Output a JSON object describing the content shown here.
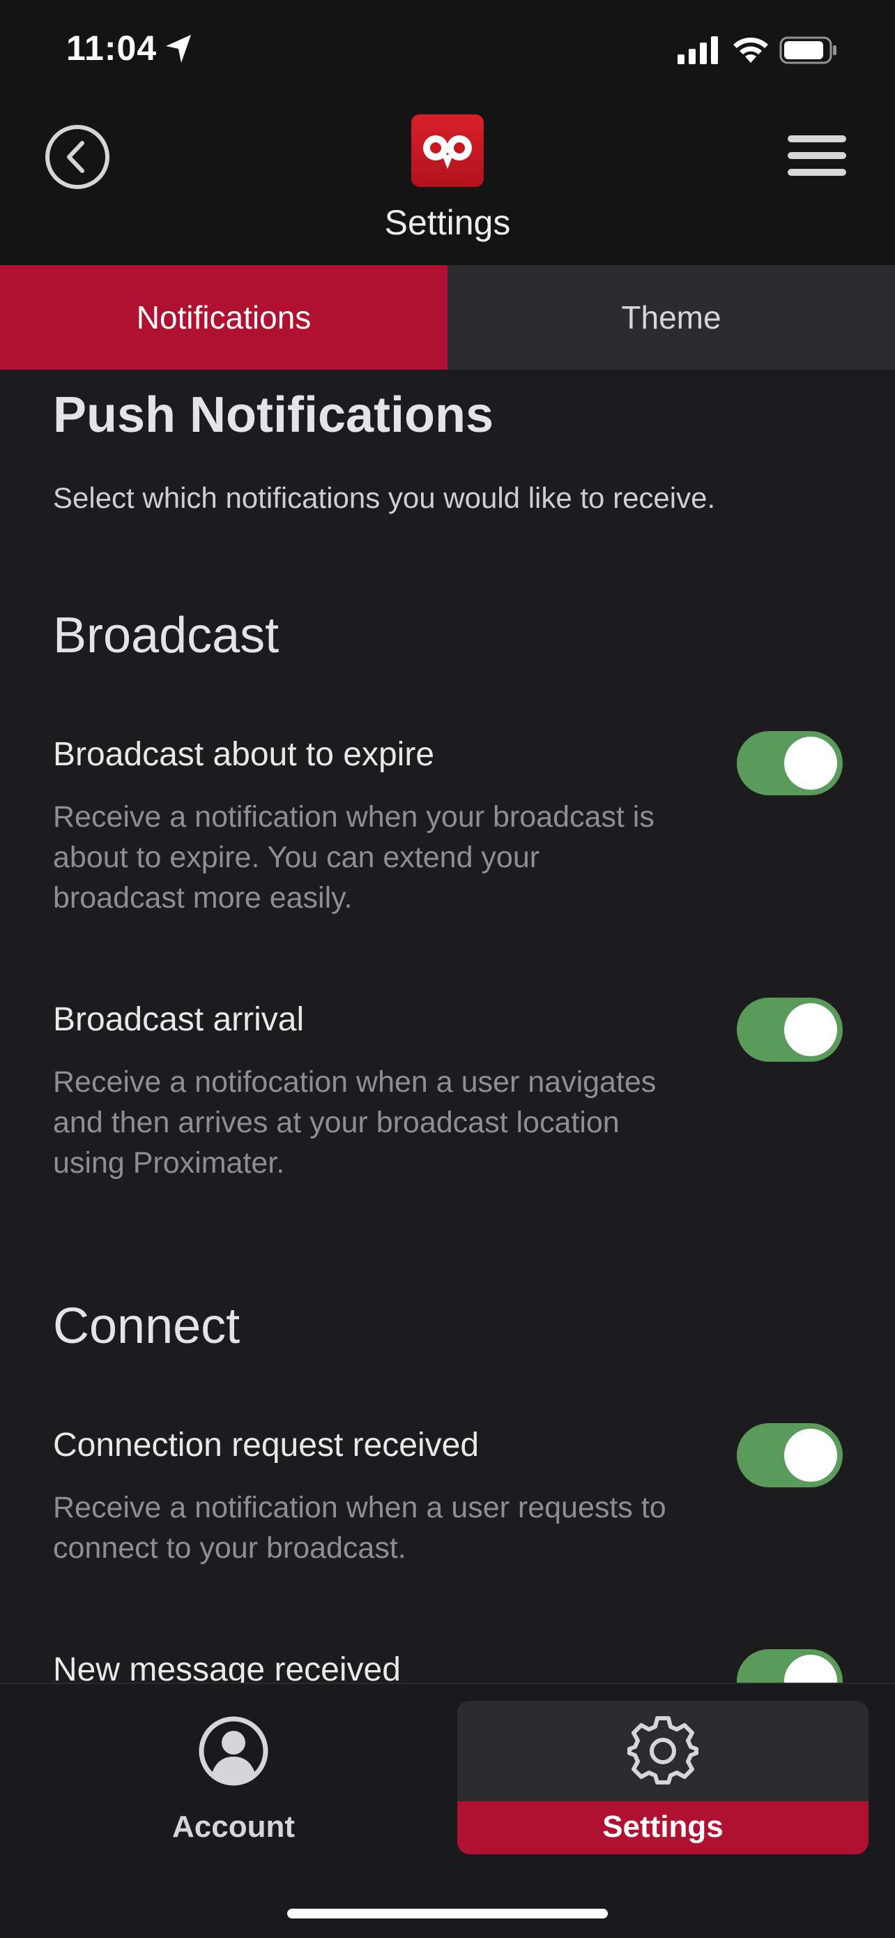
{
  "status_bar": {
    "time": "11:04"
  },
  "header": {
    "title": "Settings"
  },
  "tabs": [
    {
      "label": "Notifications",
      "active": true
    },
    {
      "label": "Theme",
      "active": false
    }
  ],
  "content": {
    "heading": "Push Notifications",
    "intro": "Select which notifications you would like to receive.",
    "sections": [
      {
        "title": "Broadcast",
        "settings": [
          {
            "title": "Broadcast about to expire",
            "description": "Receive a notification when your broadcast is about to expire. You can extend your broadcast more easily.",
            "enabled": true
          },
          {
            "title": "Broadcast arrival",
            "description": "Receive a notifocation when a user navigates and then arrives at your broadcast location using Proximater.",
            "enabled": true
          }
        ]
      },
      {
        "title": "Connect",
        "settings": [
          {
            "title": "Connection request received",
            "description": "Receive a notification when a user requests to connect to your broadcast.",
            "enabled": true
          },
          {
            "title": "New message received",
            "enabled": true
          }
        ]
      }
    ]
  },
  "bottom_nav": [
    {
      "label": "Account",
      "icon": "account-icon",
      "active": false
    },
    {
      "label": "Settings",
      "icon": "gear-icon",
      "active": true
    }
  ],
  "colors": {
    "accent": "#b01130",
    "toggle_on": "#5a9a5a",
    "background": "#1c1c1e"
  }
}
